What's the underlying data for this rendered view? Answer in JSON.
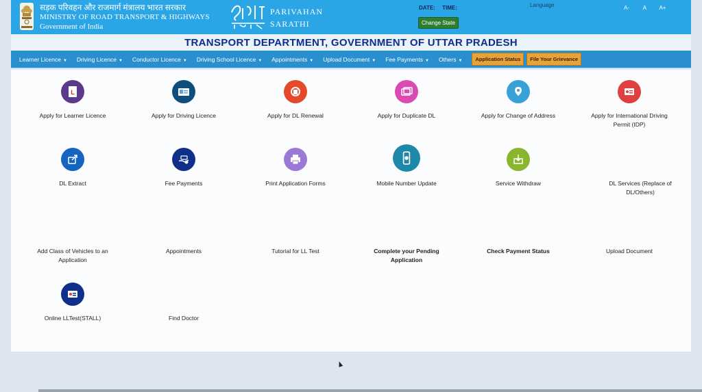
{
  "header": {
    "ministry_hindi": "सड़क परिवहन और राजमार्ग मंत्रालय भारत सरकार",
    "ministry_english": "MINISTRY OF ROAD TRANSPORT & HIGHWAYS",
    "government": "Government of India",
    "brand_line1": "PARIVAHAN",
    "brand_line2": "SARATHI",
    "date_label": "DATE:",
    "time_label": "TIME:",
    "change_state": "Change State",
    "language": "Language",
    "font_small": "A-",
    "font_normal": "A",
    "font_large": "A+"
  },
  "department_title": "TRANSPORT DEPARTMENT, GOVERNMENT OF UTTAR PRADESH",
  "nav": {
    "items": [
      "Learner Licence",
      "Driving Licence",
      "Conductor Licence",
      "Driving School Licence",
      "Appointments",
      "Upload Document",
      "Fee Payments",
      "Others"
    ],
    "application_status": "Application Status",
    "file_grievance": "File Your Grievance"
  },
  "services": {
    "apply_ll": "Apply for Learner Licence",
    "apply_dl": "Apply for Driving Licence",
    "dl_renewal": "Apply for DL Renewal",
    "duplicate_dl": "Apply for Duplicate DL",
    "change_address": "Apply for Change of Address",
    "idp_line1": "Apply for International Driving",
    "idp_line2": "Permit (IDP)",
    "dl_extract": "DL Extract",
    "fee_payments": "Fee Payments",
    "print_forms": "Print Application Forms",
    "mobile_update": "Mobile Number Update",
    "service_withdraw": "Service Withdraw",
    "dl_services_line1": "DL Services (Replace of",
    "dl_services_line2": "DL/Others)",
    "add_class_line1": "Add Class of Vehicles to an",
    "add_class_line2": "Application",
    "appointments": "Appointments",
    "tutorial": "Tutorial for LL Test",
    "pending_line1": "Complete your Pending",
    "pending_line2": "Application",
    "check_payment": "Check Payment Status",
    "upload_document": "Upload Document",
    "online_lltest": "Online LLTest(STALL)",
    "find_doctor": "Find Doctor"
  },
  "colors": {
    "header_blue": "#2aa6e6",
    "nav_blue": "#2a8fcf",
    "title_navy": "#0e2d8c",
    "button_orange": "#e8a23a"
  }
}
